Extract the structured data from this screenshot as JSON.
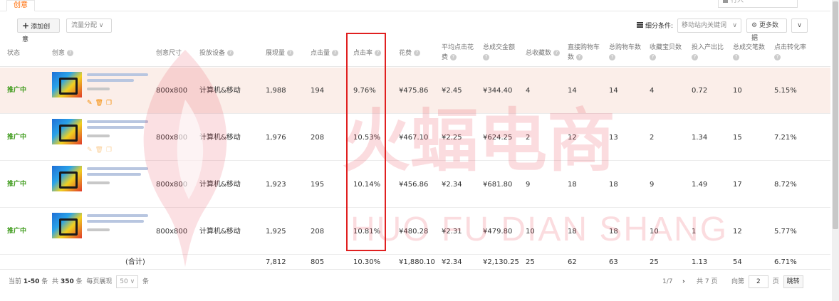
{
  "tabs": {
    "active": "创意"
  },
  "search": {
    "placeholder": "行入"
  },
  "toolbar": {
    "add_label": "添加创意",
    "flow_label": "流量分配",
    "filter_label": "细分条件:",
    "filter_value": "移动站内关键词",
    "more_label": "更多数据"
  },
  "table": {
    "headers": [
      "状态",
      "创意",
      "创意尺寸",
      "投放设备",
      "展现量",
      "点击量",
      "点击率",
      "花费",
      "平均点击花费",
      "总成交金额",
      "总收藏数",
      "直接购物车数",
      "总购物车数",
      "收藏宝贝数",
      "投入产出比",
      "总成交笔数",
      "点击转化率"
    ],
    "rows": [
      {
        "status": "推广中",
        "size": "800x800",
        "device": "计算机&移动",
        "impressions": "1,988",
        "clicks": "194",
        "ctr": "9.76%",
        "cost": "¥475.86",
        "cpc": "¥2.45",
        "gmv": "¥344.40",
        "fav": "4",
        "direct_cart": "14",
        "total_cart": "14",
        "fav_items": "4",
        "roi": "0.72",
        "orders": "10",
        "cvr": "5.15%"
      },
      {
        "status": "推广中",
        "size": "800x800",
        "device": "计算机&移动",
        "impressions": "1,976",
        "clicks": "208",
        "ctr": "10.53%",
        "cost": "¥467.10",
        "cpc": "¥2.25",
        "gmv": "¥624.25",
        "fav": "2",
        "direct_cart": "12",
        "total_cart": "13",
        "fav_items": "2",
        "roi": "1.34",
        "orders": "15",
        "cvr": "7.21%"
      },
      {
        "status": "推广中",
        "size": "800x800",
        "device": "计算机&移动",
        "impressions": "1,923",
        "clicks": "195",
        "ctr": "10.14%",
        "cost": "¥456.86",
        "cpc": "¥2.34",
        "gmv": "¥681.80",
        "fav": "9",
        "direct_cart": "18",
        "total_cart": "18",
        "fav_items": "9",
        "roi": "1.49",
        "orders": "17",
        "cvr": "8.72%"
      },
      {
        "status": "推广中",
        "size": "800x800",
        "device": "计算机&移动",
        "impressions": "1,925",
        "clicks": "208",
        "ctr": "10.81%",
        "cost": "¥480.28",
        "cpc": "¥2.31",
        "gmv": "¥479.80",
        "fav": "10",
        "direct_cart": "18",
        "total_cart": "18",
        "fav_items": "10",
        "roi": "1",
        "orders": "12",
        "cvr": "5.77%"
      }
    ],
    "total": {
      "label": "(合计)",
      "impressions": "7,812",
      "clicks": "805",
      "ctr": "10.30%",
      "cost": "¥1,880.10",
      "cpc": "¥2.34",
      "gmv": "¥2,130.25",
      "fav": "25",
      "direct_cart": "62",
      "total_cart": "63",
      "fav_items": "25",
      "roi": "1.13",
      "orders": "54",
      "cvr": "6.71%"
    }
  },
  "pagination": {
    "current_prefix": "当前",
    "current_range": "1-50",
    "current_suffix": "条",
    "total_prefix": "共",
    "total_count": "350",
    "total_suffix": "条",
    "per_page_label": "每页展现",
    "per_page": "50",
    "per_page_unit": "条",
    "page_status": "1/7",
    "total_pages": "共 7 页",
    "goto_prefix": "向第",
    "goto_value": "2",
    "goto_unit": "页",
    "goto_button": "跳转"
  },
  "watermark": {
    "text": "火蝠电商",
    "sub": "HUO FU DIAN SHANG"
  },
  "colors": {
    "accent": "#ff6a00",
    "status_active": "#3d9a1a",
    "highlight_border": "#e02020",
    "row_highlight": "#fbeee9"
  }
}
